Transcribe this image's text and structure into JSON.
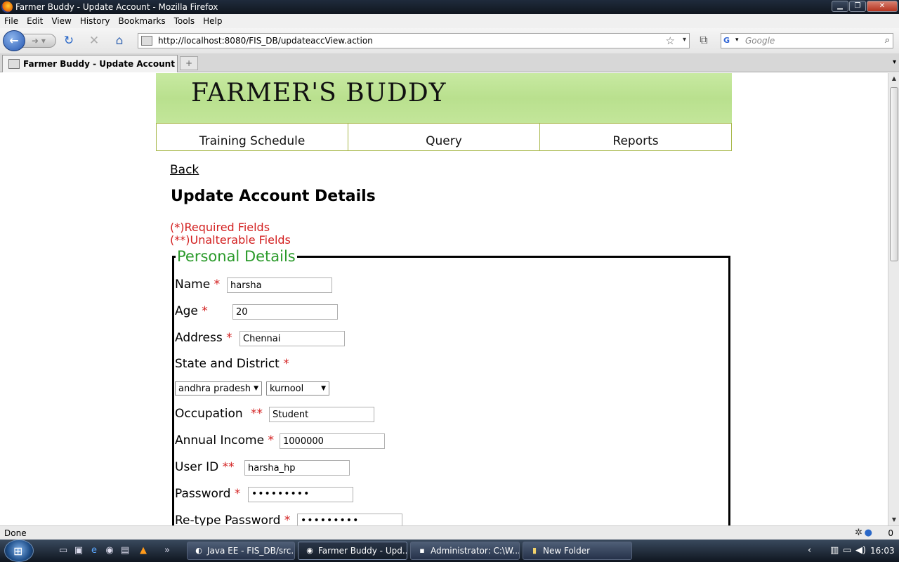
{
  "window": {
    "title": "Farmer Buddy - Update Account - Mozilla Firefox"
  },
  "menu": [
    "File",
    "Edit",
    "View",
    "History",
    "Bookmarks",
    "Tools",
    "Help"
  ],
  "toolbar": {
    "url": "http://localhost:8080/FIS_DB/updateaccView.action",
    "search_placeholder": "Google"
  },
  "tabs": [
    {
      "label": "Farmer Buddy - Update Account"
    }
  ],
  "page": {
    "brand": "FARMER'S BUDDY",
    "nav": [
      "Training Schedule",
      "Query",
      "Reports"
    ],
    "back": "Back",
    "heading": "Update Account Details",
    "required_note": "(*)Required Fields",
    "unalterable_note": "(**)Unalterable Fields",
    "legend": "Personal Details",
    "fields": {
      "name": {
        "label": "Name",
        "mark": "*",
        "value": "harsha"
      },
      "age": {
        "label": "Age",
        "mark": "*",
        "value": "20"
      },
      "address": {
        "label": "Address",
        "mark": "*",
        "value": "Chennai"
      },
      "state_district": {
        "label": "State and District",
        "mark": "*",
        "state": "andhra pradesh",
        "district": "kurnool"
      },
      "occupation": {
        "label": "Occupation",
        "mark": "**",
        "value": "Student"
      },
      "income": {
        "label": "Annual Income",
        "mark": "*",
        "value": "1000000"
      },
      "userid": {
        "label": "User ID",
        "mark": "**",
        "value": "harsha_hp"
      },
      "password": {
        "label": "Password",
        "mark": "*",
        "value": "•••••••••"
      },
      "retype": {
        "label": "Re-type Password",
        "mark": "*",
        "value": "•••••••••"
      }
    }
  },
  "status": {
    "text": "Done",
    "count": "0"
  },
  "taskbar": {
    "buttons": [
      "Java EE - FIS_DB/src...",
      "Farmer Buddy - Upd...",
      "Administrator: C:\\W...",
      "New Folder"
    ],
    "clock": "16:03"
  }
}
